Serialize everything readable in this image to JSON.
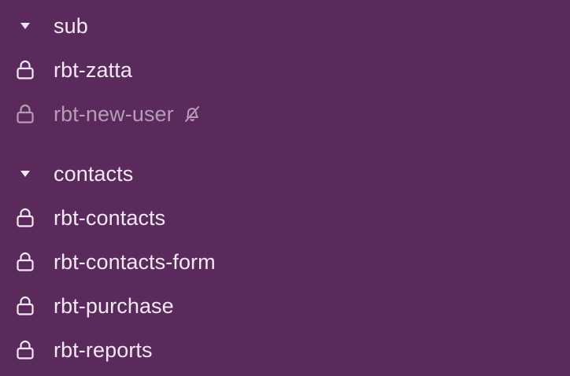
{
  "colors": {
    "background": "#5a2a5c",
    "text": "#f2e9f2",
    "muted_text": "#b79cb8"
  },
  "sections": [
    {
      "name": "sub",
      "icon": "caret-down-icon",
      "channels": [
        {
          "name": "rbt-zatta",
          "icon": "lock-icon",
          "muted": false
        },
        {
          "name": "rbt-new-user",
          "icon": "lock-icon",
          "muted": true,
          "status_icon": "bell-off-icon"
        }
      ]
    },
    {
      "name": "contacts",
      "icon": "caret-down-icon",
      "channels": [
        {
          "name": "rbt-contacts",
          "icon": "lock-icon",
          "muted": false
        },
        {
          "name": "rbt-contacts-form",
          "icon": "lock-icon",
          "muted": false
        },
        {
          "name": "rbt-purchase",
          "icon": "lock-icon",
          "muted": false
        },
        {
          "name": "rbt-reports",
          "icon": "lock-icon",
          "muted": false
        }
      ]
    }
  ]
}
